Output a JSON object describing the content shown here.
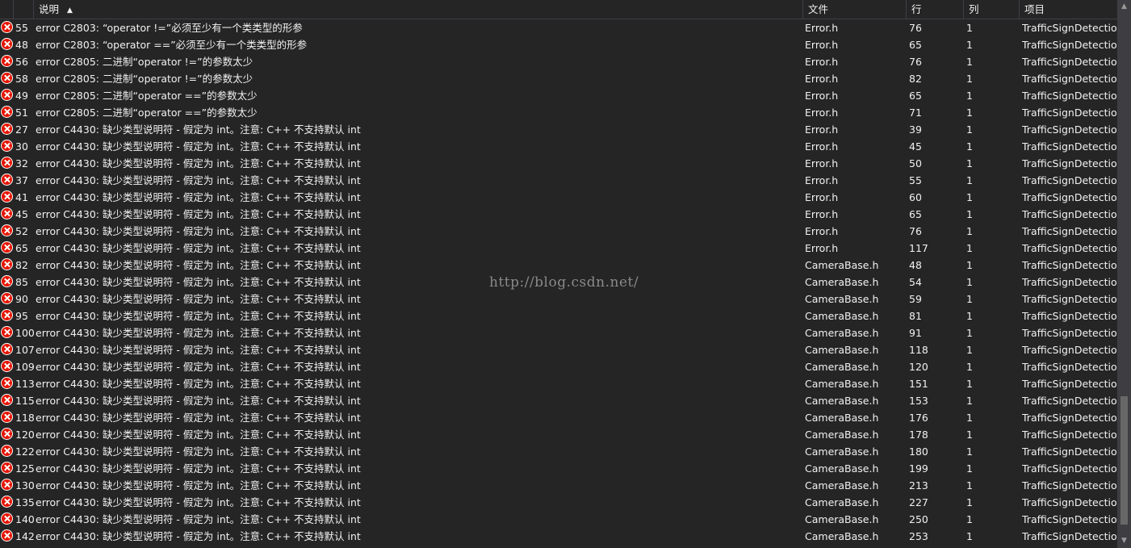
{
  "columns": {
    "description": "说明",
    "file": "文件",
    "line": "行",
    "column": "列",
    "project": "项目"
  },
  "sort_indicator": "▲",
  "icon": "error-icon",
  "colors": {
    "error": "#e51400",
    "background": "#252526",
    "text": "#f1f1f1"
  },
  "rows": [
    {
      "num": "55",
      "desc": "error C2803: “operator !=”必须至少有一个类类型的形参",
      "file": "Error.h",
      "line": "76",
      "col": "1",
      "proj": "TrafficSignDetection"
    },
    {
      "num": "48",
      "desc": "error C2803: “operator ==”必须至少有一个类类型的形参",
      "file": "Error.h",
      "line": "65",
      "col": "1",
      "proj": "TrafficSignDetection"
    },
    {
      "num": "56",
      "desc": "error C2805: 二进制“operator !=”的参数太少",
      "file": "Error.h",
      "line": "76",
      "col": "1",
      "proj": "TrafficSignDetection"
    },
    {
      "num": "58",
      "desc": "error C2805: 二进制“operator !=”的参数太少",
      "file": "Error.h",
      "line": "82",
      "col": "1",
      "proj": "TrafficSignDetection"
    },
    {
      "num": "49",
      "desc": "error C2805: 二进制“operator ==”的参数太少",
      "file": "Error.h",
      "line": "65",
      "col": "1",
      "proj": "TrafficSignDetection"
    },
    {
      "num": "51",
      "desc": "error C2805: 二进制“operator ==”的参数太少",
      "file": "Error.h",
      "line": "71",
      "col": "1",
      "proj": "TrafficSignDetection"
    },
    {
      "num": "27",
      "desc": "error C4430: 缺少类型说明符 - 假定为 int。注意: C++ 不支持默认 int",
      "file": "Error.h",
      "line": "39",
      "col": "1",
      "proj": "TrafficSignDetection"
    },
    {
      "num": "30",
      "desc": "error C4430: 缺少类型说明符 - 假定为 int。注意: C++ 不支持默认 int",
      "file": "Error.h",
      "line": "45",
      "col": "1",
      "proj": "TrafficSignDetection"
    },
    {
      "num": "32",
      "desc": "error C4430: 缺少类型说明符 - 假定为 int。注意: C++ 不支持默认 int",
      "file": "Error.h",
      "line": "50",
      "col": "1",
      "proj": "TrafficSignDetection"
    },
    {
      "num": "37",
      "desc": "error C4430: 缺少类型说明符 - 假定为 int。注意: C++ 不支持默认 int",
      "file": "Error.h",
      "line": "55",
      "col": "1",
      "proj": "TrafficSignDetection"
    },
    {
      "num": "41",
      "desc": "error C4430: 缺少类型说明符 - 假定为 int。注意: C++ 不支持默认 int",
      "file": "Error.h",
      "line": "60",
      "col": "1",
      "proj": "TrafficSignDetection"
    },
    {
      "num": "45",
      "desc": "error C4430: 缺少类型说明符 - 假定为 int。注意: C++ 不支持默认 int",
      "file": "Error.h",
      "line": "65",
      "col": "1",
      "proj": "TrafficSignDetection"
    },
    {
      "num": "52",
      "desc": "error C4430: 缺少类型说明符 - 假定为 int。注意: C++ 不支持默认 int",
      "file": "Error.h",
      "line": "76",
      "col": "1",
      "proj": "TrafficSignDetection"
    },
    {
      "num": "65",
      "desc": "error C4430: 缺少类型说明符 - 假定为 int。注意: C++ 不支持默认 int",
      "file": "Error.h",
      "line": "117",
      "col": "1",
      "proj": "TrafficSignDetection"
    },
    {
      "num": "82",
      "desc": "error C4430: 缺少类型说明符 - 假定为 int。注意: C++ 不支持默认 int",
      "file": "CameraBase.h",
      "line": "48",
      "col": "1",
      "proj": "TrafficSignDetection"
    },
    {
      "num": "85",
      "desc": "error C4430: 缺少类型说明符 - 假定为 int。注意: C++ 不支持默认 int",
      "file": "CameraBase.h",
      "line": "54",
      "col": "1",
      "proj": "TrafficSignDetection"
    },
    {
      "num": "90",
      "desc": "error C4430: 缺少类型说明符 - 假定为 int。注意: C++ 不支持默认 int",
      "file": "CameraBase.h",
      "line": "59",
      "col": "1",
      "proj": "TrafficSignDetection"
    },
    {
      "num": "95",
      "desc": "error C4430: 缺少类型说明符 - 假定为 int。注意: C++ 不支持默认 int",
      "file": "CameraBase.h",
      "line": "81",
      "col": "1",
      "proj": "TrafficSignDetection"
    },
    {
      "num": "100",
      "desc": "error C4430: 缺少类型说明符 - 假定为 int。注意: C++ 不支持默认 int",
      "file": "CameraBase.h",
      "line": "91",
      "col": "1",
      "proj": "TrafficSignDetection"
    },
    {
      "num": "107",
      "desc": "error C4430: 缺少类型说明符 - 假定为 int。注意: C++ 不支持默认 int",
      "file": "CameraBase.h",
      "line": "118",
      "col": "1",
      "proj": "TrafficSignDetection"
    },
    {
      "num": "109",
      "desc": "error C4430: 缺少类型说明符 - 假定为 int。注意: C++ 不支持默认 int",
      "file": "CameraBase.h",
      "line": "120",
      "col": "1",
      "proj": "TrafficSignDetection"
    },
    {
      "num": "113",
      "desc": "error C4430: 缺少类型说明符 - 假定为 int。注意: C++ 不支持默认 int",
      "file": "CameraBase.h",
      "line": "151",
      "col": "1",
      "proj": "TrafficSignDetection"
    },
    {
      "num": "115",
      "desc": "error C4430: 缺少类型说明符 - 假定为 int。注意: C++ 不支持默认 int",
      "file": "CameraBase.h",
      "line": "153",
      "col": "1",
      "proj": "TrafficSignDetection"
    },
    {
      "num": "118",
      "desc": "error C4430: 缺少类型说明符 - 假定为 int。注意: C++ 不支持默认 int",
      "file": "CameraBase.h",
      "line": "176",
      "col": "1",
      "proj": "TrafficSignDetection"
    },
    {
      "num": "120",
      "desc": "error C4430: 缺少类型说明符 - 假定为 int。注意: C++ 不支持默认 int",
      "file": "CameraBase.h",
      "line": "178",
      "col": "1",
      "proj": "TrafficSignDetection"
    },
    {
      "num": "122",
      "desc": "error C4430: 缺少类型说明符 - 假定为 int。注意: C++ 不支持默认 int",
      "file": "CameraBase.h",
      "line": "180",
      "col": "1",
      "proj": "TrafficSignDetection"
    },
    {
      "num": "125",
      "desc": "error C4430: 缺少类型说明符 - 假定为 int。注意: C++ 不支持默认 int",
      "file": "CameraBase.h",
      "line": "199",
      "col": "1",
      "proj": "TrafficSignDetection"
    },
    {
      "num": "130",
      "desc": "error C4430: 缺少类型说明符 - 假定为 int。注意: C++ 不支持默认 int",
      "file": "CameraBase.h",
      "line": "213",
      "col": "1",
      "proj": "TrafficSignDetection"
    },
    {
      "num": "135",
      "desc": "error C4430: 缺少类型说明符 - 假定为 int。注意: C++ 不支持默认 int",
      "file": "CameraBase.h",
      "line": "227",
      "col": "1",
      "proj": "TrafficSignDetection"
    },
    {
      "num": "140",
      "desc": "error C4430: 缺少类型说明符 - 假定为 int。注意: C++ 不支持默认 int",
      "file": "CameraBase.h",
      "line": "250",
      "col": "1",
      "proj": "TrafficSignDetection"
    },
    {
      "num": "142",
      "desc": "error C4430: 缺少类型说明符 - 假定为 int。注意: C++ 不支持默认 int",
      "file": "CameraBase.h",
      "line": "253",
      "col": "1",
      "proj": "TrafficSignDetection"
    }
  ],
  "watermark": "http://blog.csdn.net/"
}
